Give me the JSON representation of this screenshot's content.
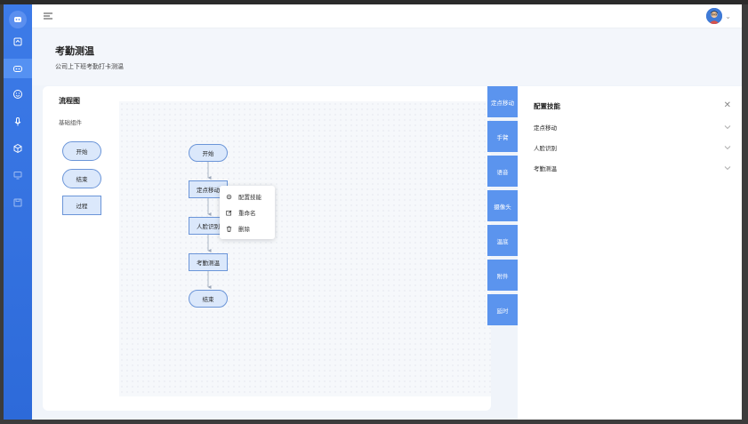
{
  "header": {
    "menu_icon": "menu-icon",
    "avatar_icon": "avatar"
  },
  "page": {
    "title": "考勤测温",
    "subtitle": "公司上下班考勤打卡测温"
  },
  "workspace": {
    "title": "流程图",
    "group_label": "基础组件",
    "palette": [
      {
        "label": "开始",
        "shape": "round"
      },
      {
        "label": "结束",
        "shape": "round"
      },
      {
        "label": "过程",
        "shape": "rect"
      }
    ],
    "flow_nodes": [
      {
        "label": "开始",
        "shape": "round"
      },
      {
        "label": "定点移动",
        "shape": "rect"
      },
      {
        "label": "人脸识别",
        "shape": "rect"
      },
      {
        "label": "考勤测温",
        "shape": "rect"
      },
      {
        "label": "结束",
        "shape": "round"
      }
    ],
    "context_menu": [
      {
        "label": "配置技能",
        "icon": "gear-icon"
      },
      {
        "label": "重命名",
        "icon": "edit-icon"
      },
      {
        "label": "删除",
        "icon": "trash-icon"
      }
    ]
  },
  "skill_tabs": [
    "定点移动",
    "手臂",
    "语音",
    "摄像头",
    "温底",
    "附件",
    "延时"
  ],
  "panel": {
    "title": "配置技能",
    "sections": [
      "定点移动",
      "人脸识别",
      "考勤测温"
    ]
  },
  "colors": {
    "rail": "#2d6ad9",
    "accent": "#5b94ee",
    "node_fill": "#dbe8fb",
    "node_border": "#6b95d8"
  }
}
